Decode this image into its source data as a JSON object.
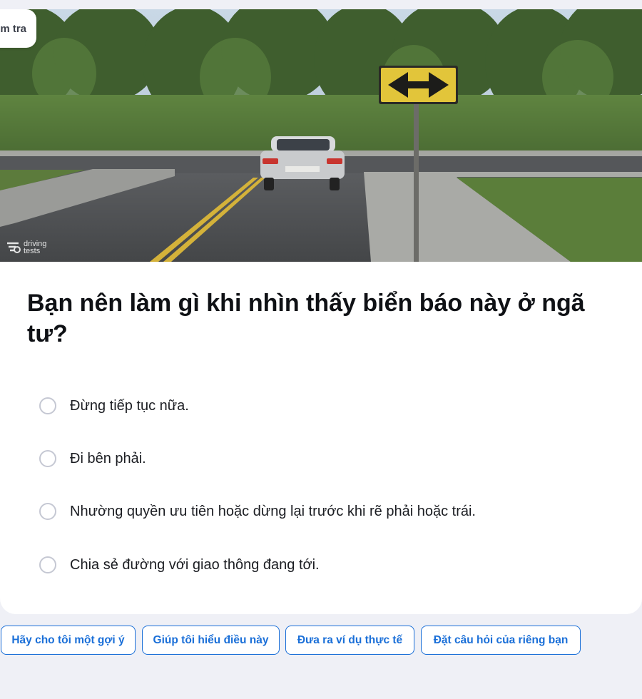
{
  "header": {
    "test_chip_label": "m tra"
  },
  "image": {
    "watermark_line1": "driving",
    "watermark_line2": "tests"
  },
  "question": {
    "text": "Bạn nên làm gì khi nhìn thấy biển báo này ở ngã tư?"
  },
  "answers": [
    {
      "label": "Đừng tiếp tục nữa."
    },
    {
      "label": "Đi bên phải."
    },
    {
      "label": "Nhường quyền ưu tiên hoặc dừng lại trước khi rẽ phải hoặc trái."
    },
    {
      "label": "Chia sẻ đường với giao thông đang tới."
    }
  ],
  "help_chips": [
    {
      "label": "Hãy cho tôi một gợi ý"
    },
    {
      "label": "Giúp tôi hiểu điều này"
    },
    {
      "label": "Đưa ra ví dụ thực tế"
    },
    {
      "label": "Đặt câu hỏi của riêng bạn"
    }
  ],
  "colors": {
    "accent": "#1a6fd8",
    "page_bg": "#eff0f6",
    "sign_yellow": "#e2c53a"
  }
}
